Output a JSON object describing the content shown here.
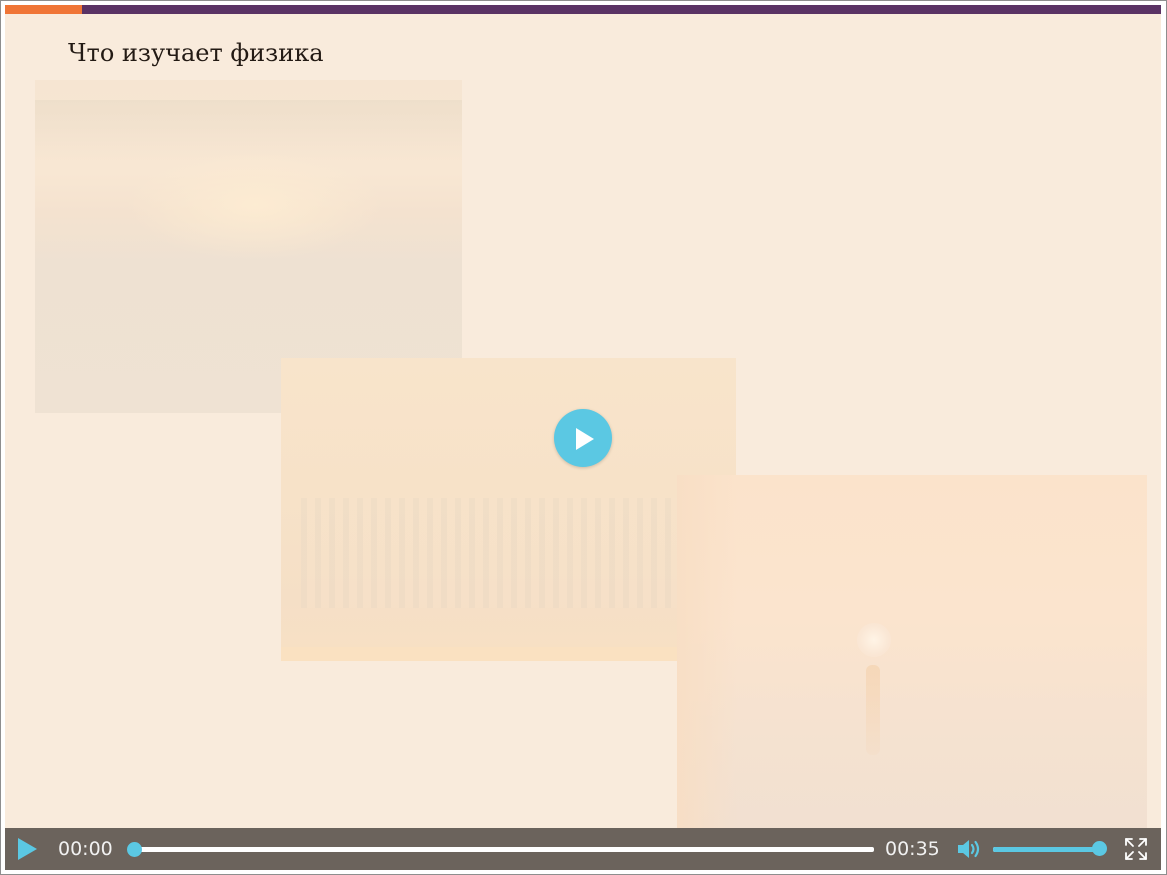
{
  "slide": {
    "title": "Что изучает физика",
    "background_color": "#f9ebdc",
    "top_bar_color": "#5a3264",
    "top_bar_accent_color": "#f07536"
  },
  "overlay": {
    "play_icon": "play-icon",
    "accent_color": "#5bc8e3"
  },
  "player": {
    "current_time": "00:00",
    "total_time": "00:35",
    "progress": 0.0,
    "volume": 1.0,
    "controls_background": "#6b635c",
    "icons": {
      "play": "play-icon",
      "volume": "volume-icon",
      "fullscreen": "fullscreen-icon"
    }
  }
}
